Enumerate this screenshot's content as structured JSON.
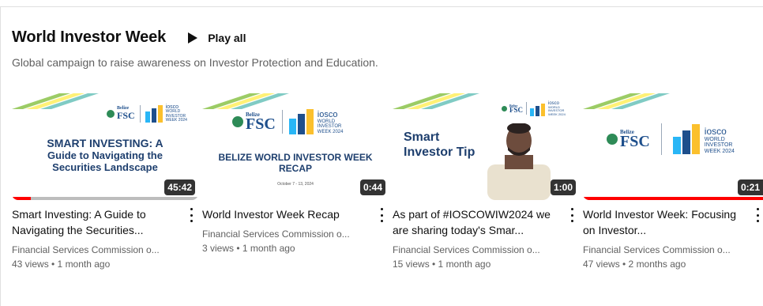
{
  "shelf": {
    "title": "World Investor Week",
    "play_all_label": "Play all",
    "description": "Global campaign to raise awareness on Investor Protection and Education."
  },
  "icons": {
    "play": "play-icon",
    "more": "more-vert-icon"
  },
  "colors": {
    "progress_red": "#ff0000",
    "text_primary": "#0f0f0f",
    "text_secondary": "#606060",
    "brand_navy": "#1e3f6e"
  },
  "videos": [
    {
      "title": "Smart Investing: A Guide to Navigating the Securities...",
      "channel": "Financial Services Commission o...",
      "stats": "43 views • 1 month ago",
      "duration": "45:42",
      "watched_fraction": 0.1,
      "thumb": {
        "logo_left": "FSC",
        "logo_left_small": "Belize",
        "logo_right_lines": [
          "iosco",
          "WORLD",
          "INVESTOR",
          "WEEK 2024"
        ],
        "headline_lines": [
          "SMART INVESTING: A",
          "Guide to Navigating the",
          "Securities Landscape"
        ]
      }
    },
    {
      "title": "World Investor Week Recap",
      "channel": "Financial Services Commission o...",
      "stats": "3 views • 1 month ago",
      "duration": "0:44",
      "watched_fraction": 0,
      "thumb": {
        "logo_left": "FSC",
        "logo_left_small": "Belize",
        "logo_right_lines": [
          "iosco",
          "WORLD",
          "INVESTOR",
          "WEEK 2024"
        ],
        "headline_lines": [
          "BELIZE WORLD INVESTOR WEEK",
          "RECAP"
        ],
        "subline": "October 7 - 13, 2024"
      }
    },
    {
      "title": "As part of #IOSCOWIW2024 we are sharing today's Smar...",
      "channel": "Financial Services Commission o...",
      "stats": "15 views • 1 month ago",
      "duration": "1:00",
      "watched_fraction": 0,
      "thumb": {
        "logo_left": "FSC",
        "logo_left_small": "Belize",
        "logo_right_lines": [
          "iosco",
          "WORLD",
          "INVESTOR",
          "WEEK 2024"
        ],
        "headline_lines": [
          "Smart",
          "Investor Tip"
        ]
      }
    },
    {
      "title": "World Investor Week: Focusing on Investor...",
      "channel": "Financial Services Commission o...",
      "stats": "47 views • 2 months ago",
      "duration": "0:21",
      "watched_fraction": 1.0,
      "thumb": {
        "logo_left": "FSC",
        "logo_left_small": "Belize",
        "logo_right_lines": [
          "iosco",
          "WORLD",
          "INVESTOR",
          "WEEK 2024"
        ]
      }
    }
  ]
}
